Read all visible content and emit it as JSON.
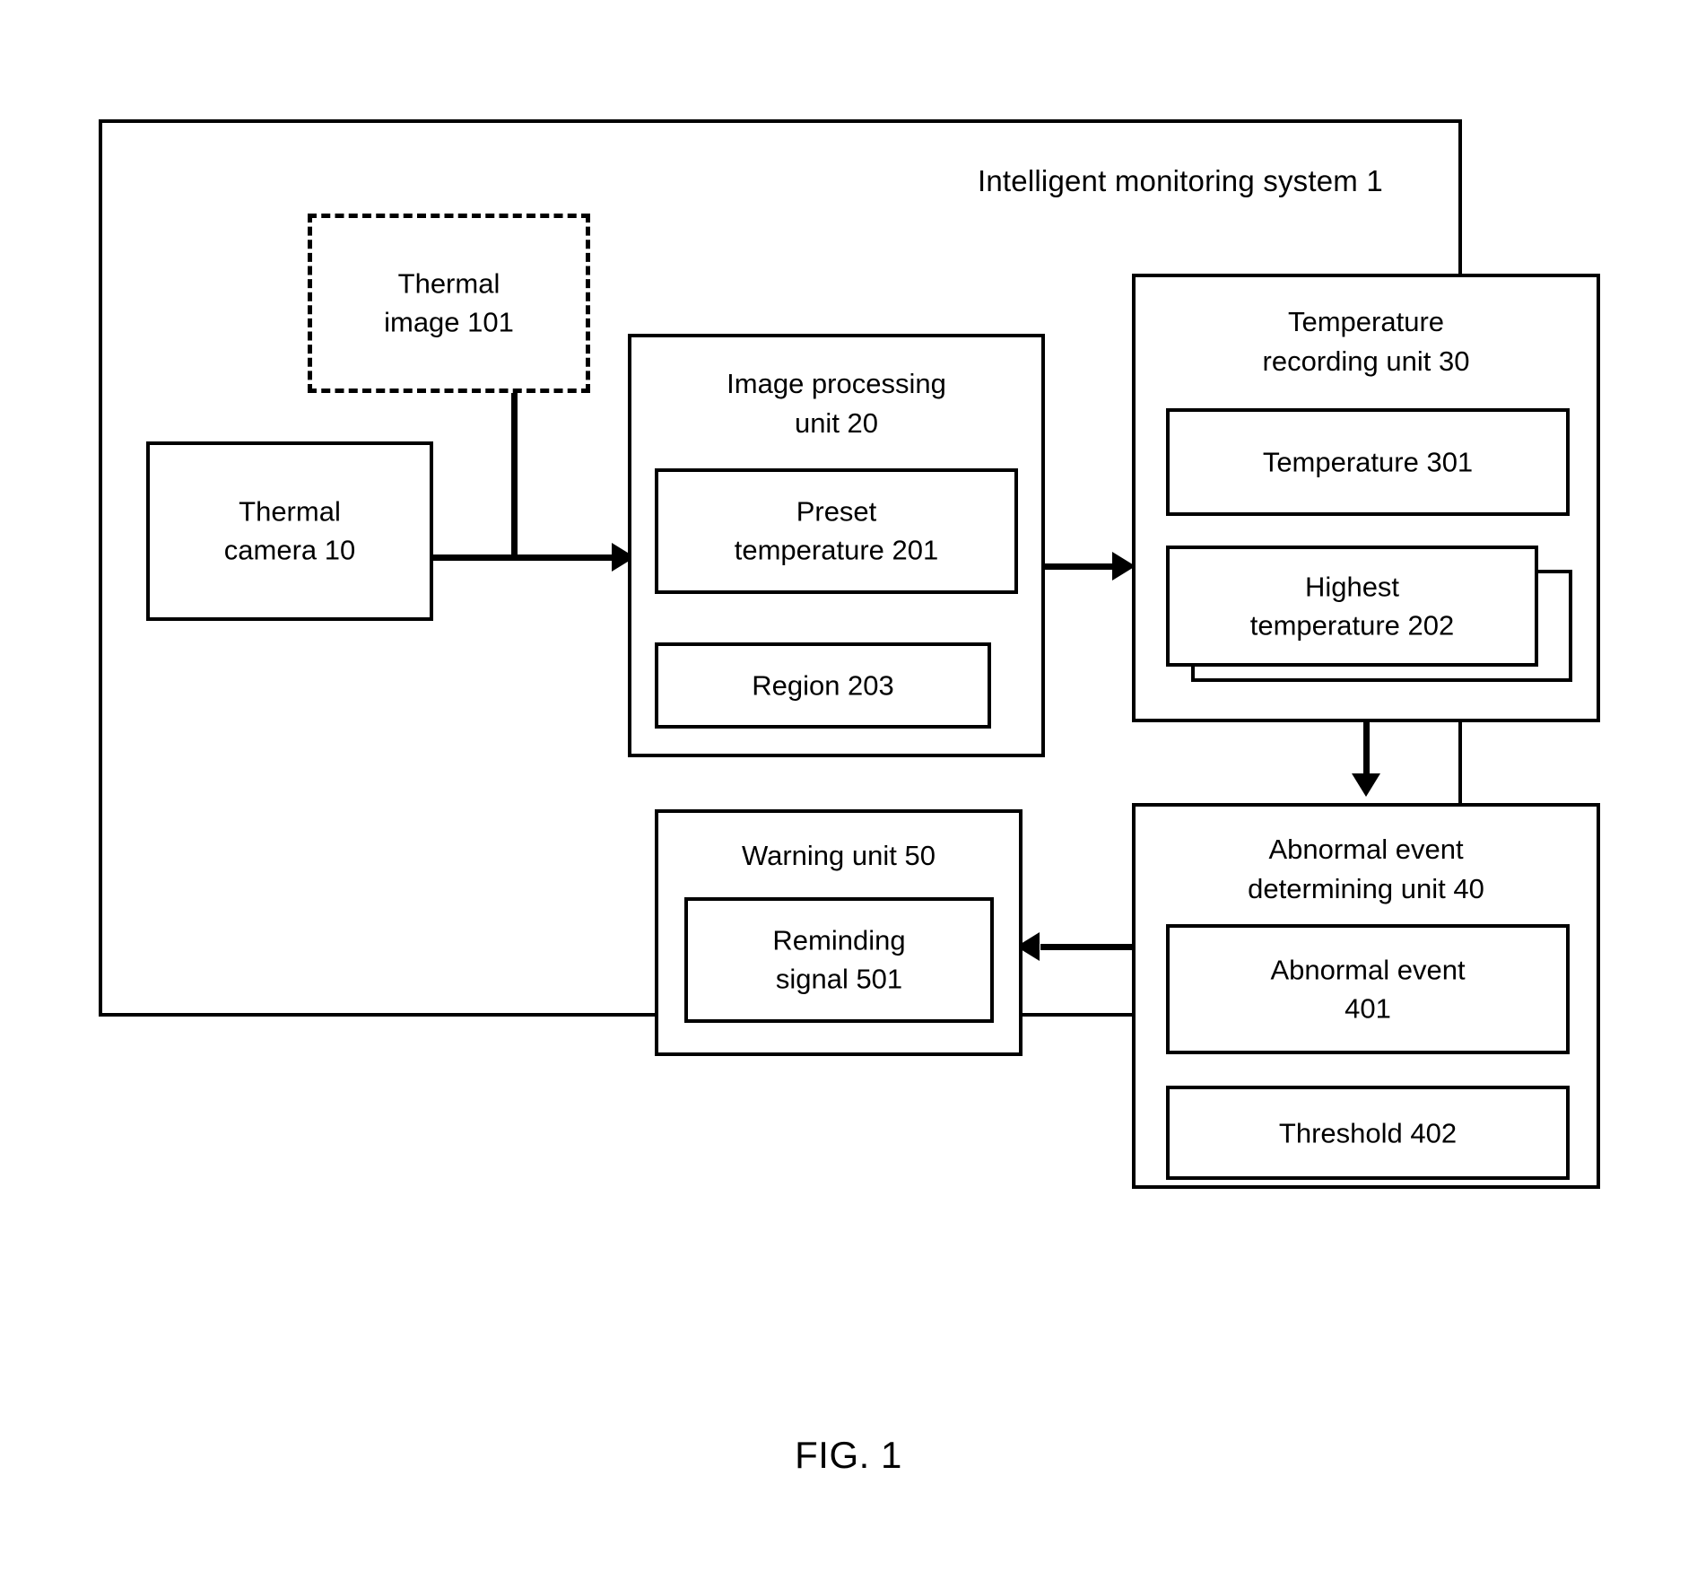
{
  "figure": {
    "caption": "FIG. 1"
  },
  "system": {
    "title": "Intelligent monitoring system  1"
  },
  "blocks": {
    "thermal_image": {
      "label": "Thermal\nimage 101"
    },
    "thermal_camera": {
      "label": "Thermal\ncamera 10"
    },
    "image_processing_unit": {
      "title": "Image processing\nunit   20"
    },
    "preset_temperature": {
      "label": "Preset\ntemperature 201"
    },
    "region": {
      "label": "Region 203"
    },
    "temperature_recording_unit": {
      "title": "Temperature\nrecording unit   30"
    },
    "temperature": {
      "label": "Temperature  301"
    },
    "highest_temperature": {
      "label": "Highest\ntemperature 202"
    },
    "abnormal_event_determining_unit": {
      "title": "Abnormal event\ndetermining unit   40"
    },
    "abnormal_event": {
      "label": "Abnormal event\n401"
    },
    "threshold": {
      "label": "Threshold   402"
    },
    "warning_unit": {
      "title": "Warning unit 50"
    },
    "reminding_signal": {
      "label": "Reminding\nsignal   501"
    }
  },
  "colors": {
    "stroke": "#000000",
    "background": "#ffffff"
  }
}
